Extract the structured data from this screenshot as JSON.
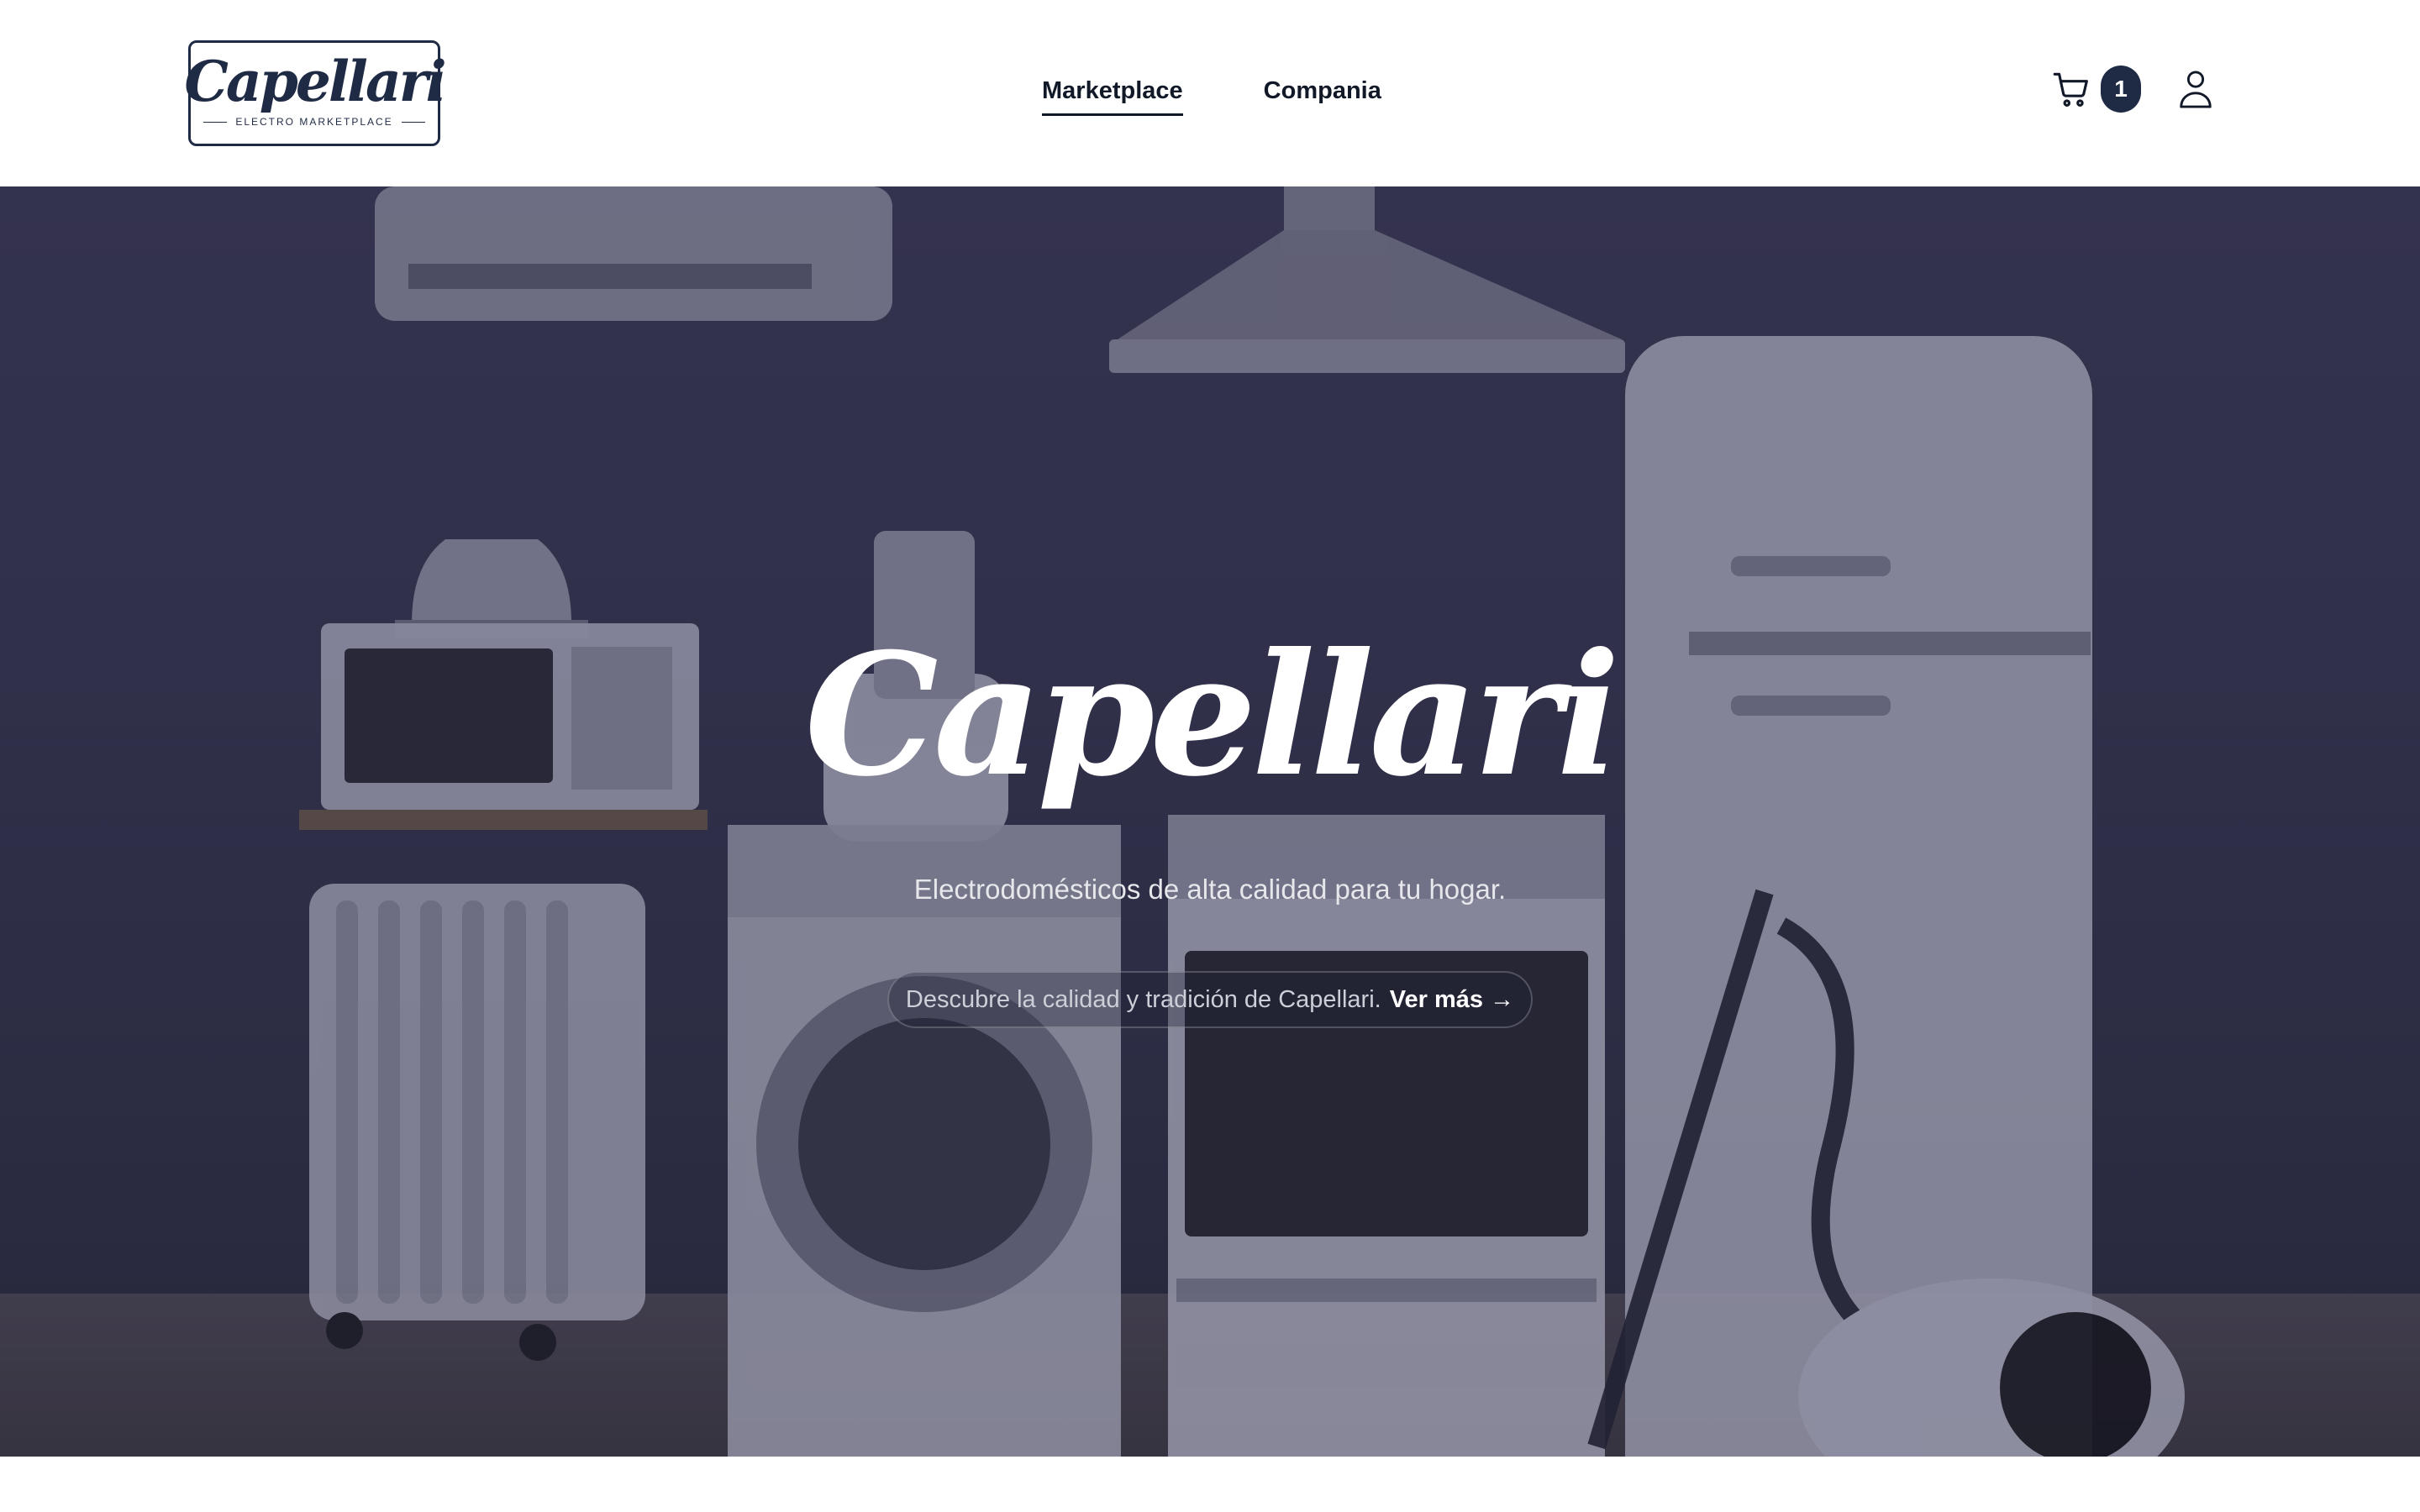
{
  "header": {
    "logo": {
      "script_text": "Capellari",
      "subtitle": "ELECTRO MARKETPLACE"
    },
    "nav": [
      {
        "label": "Marketplace",
        "active": true
      },
      {
        "label": "Compania",
        "active": false
      }
    ],
    "cart": {
      "icon": "cart-icon",
      "count": "1"
    },
    "user": {
      "icon": "user-icon"
    }
  },
  "hero": {
    "title": "Capellari",
    "subtitle": "Electrodomésticos de alta calidad para tu hogar.",
    "pill_text": "Descubre la calidad y tradición de Capellari.",
    "pill_link": "Ver más →"
  },
  "colors": {
    "brand_navy": "#1f2a44",
    "hero_bg": "#34344f",
    "header_bg": "#ffffff"
  }
}
